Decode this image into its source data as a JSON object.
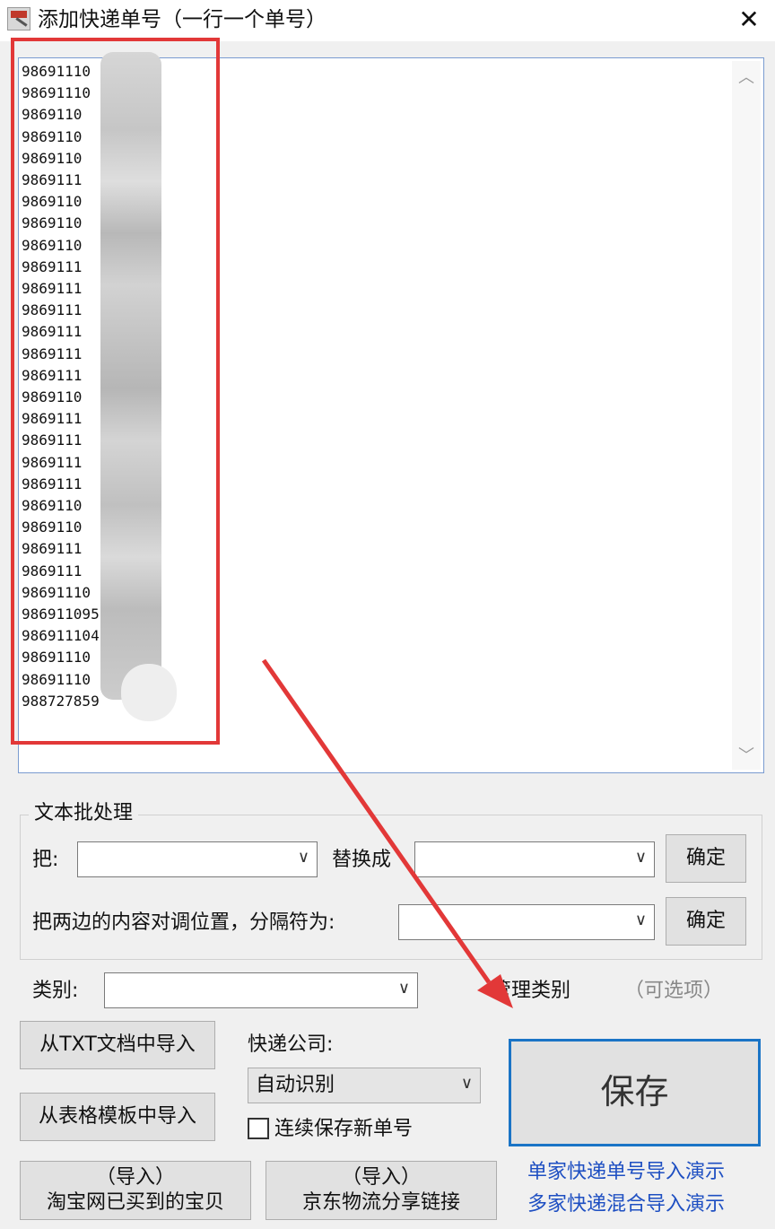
{
  "window": {
    "title": "添加快递单号（一行一个单号）",
    "close_label": "✕"
  },
  "tracking_numbers": [
    "98691110",
    "98691110",
    "9869110",
    "9869110",
    "9869110",
    "9869111",
    "9869110",
    "9869110",
    "9869110",
    "9869111",
    "9869111",
    "9869111",
    "9869111",
    "9869111",
    "9869111",
    "9869110",
    "9869111",
    "9869111",
    "9869111",
    "9869111",
    "9869110",
    "9869110",
    "9869111",
    "9869111",
    "98691110",
    "986911095",
    "986911104",
    "98691110",
    "98691110",
    "988727859"
  ],
  "batch": {
    "group_title": "文本批处理",
    "find_label": "把:",
    "replace_label": "替换成",
    "confirm_label_1": "确定",
    "swap_label": "把两边的内容对调位置，分隔符为:",
    "confirm_label_2": "确定"
  },
  "category": {
    "label": "类别:",
    "manage_label": "管理类别",
    "optional_label": "（可选项）"
  },
  "import": {
    "txt_label": "从TXT文档中导入",
    "template_label": "从表格模板中导入",
    "taobao_top": "（导入）",
    "taobao_bottom": "淘宝网已买到的宝贝",
    "jd_top": "（导入）",
    "jd_bottom": "京东物流分享链接"
  },
  "courier": {
    "label": "快递公司:",
    "selected": "自动识别"
  },
  "continuous_save": {
    "label": "连续保存新单号",
    "checked": false
  },
  "save_label": "保存",
  "links": {
    "single_demo": "单家快递单号导入演示",
    "multi_demo": "多家快递混合导入演示"
  },
  "colors": {
    "accent": "#1a74c6",
    "highlight": "#e23838",
    "link": "#1e4fc2"
  }
}
